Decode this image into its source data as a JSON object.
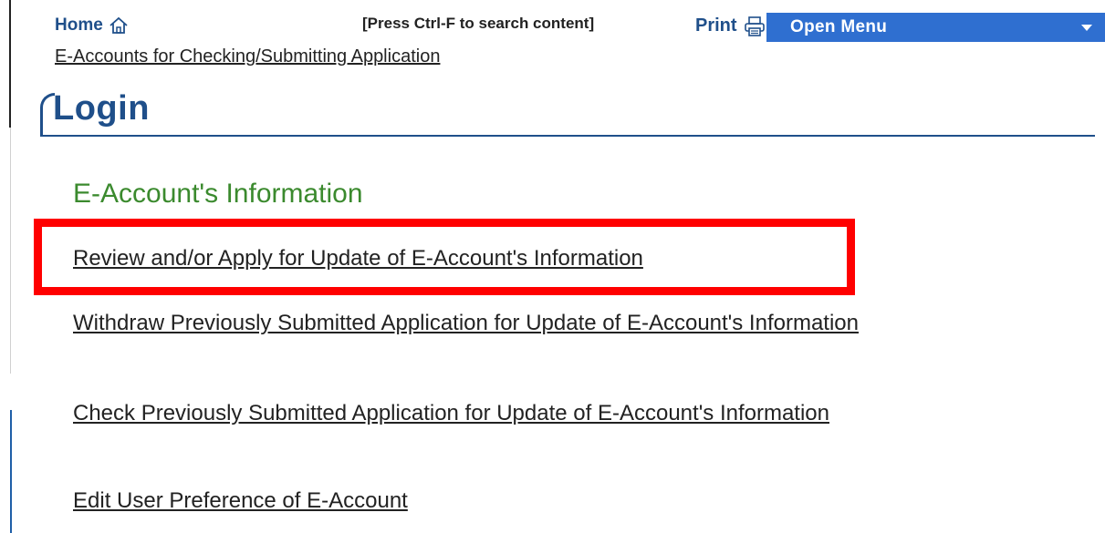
{
  "topbar": {
    "home_label": "Home",
    "home_icon": "home-icon",
    "search_hint": "[Press Ctrl-F to search content]",
    "print_label": "Print",
    "print_icon": "printer-icon",
    "menu_label": "Open Menu",
    "menu_color": "#2f6fd0"
  },
  "breadcrumb": "E-Accounts for Checking/Submitting Application",
  "page": {
    "title": "Login",
    "title_color": "#1f4f8a"
  },
  "section": {
    "heading": "E-Account's Information",
    "heading_color": "#3b8a2e",
    "links": [
      "Review and/or Apply for Update of E-Account's Information",
      "Withdraw Previously Submitted Application for Update of E-Account's Information",
      "Check Previously Submitted Application for Update of E-Account's Information",
      "Edit User Preference of E-Account"
    ]
  },
  "highlight_color": "#ff0000"
}
